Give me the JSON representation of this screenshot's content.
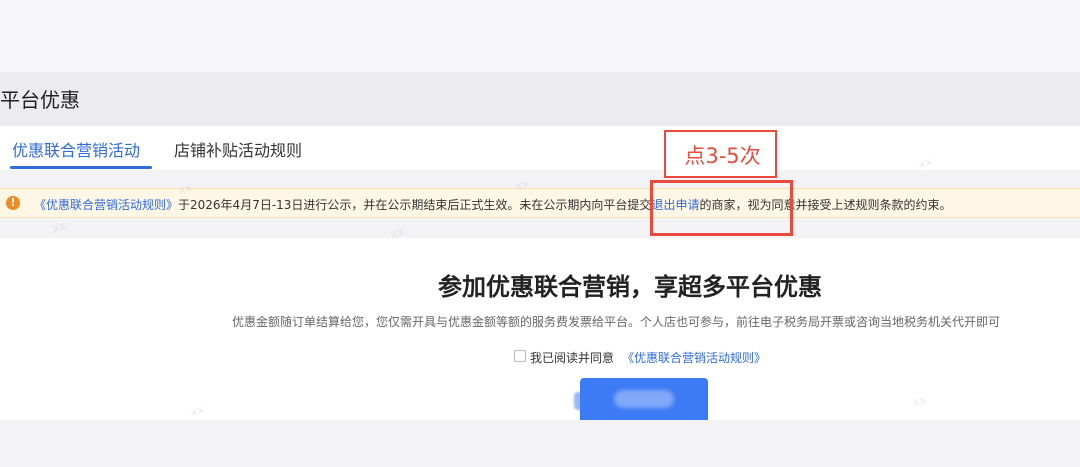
{
  "page": {
    "title": "平台优惠"
  },
  "tabs": [
    {
      "label": "优惠联合营销活动",
      "active": true
    },
    {
      "label": "店铺补贴活动规则",
      "active": false
    }
  ],
  "notice": {
    "icon": "warning-circle-icon",
    "icon_glyph": "!",
    "rules_link": "《优惠联合营销活动规则》",
    "text_before": "于2026年4月7日-13日进行公示，并在公示期结束后正式生效。未在公示期内向平台提交",
    "exit_link": "退出申请",
    "text_after": "的商家，视为同意并接受上述规则条款的约束。"
  },
  "annotation": {
    "label": "点3-5次",
    "color": "#e84b3c"
  },
  "main": {
    "title": "参加优惠联合营销，享超多平台优惠",
    "description": "优惠金额随订单结算给您，您仅需开具与优惠金额等额的服务费发票给平台。个人店也可参与，前往电子税务局开票或咨询当地税务机关代开即可",
    "agree_text": "我已阅读并同意",
    "agree_link": "《优惠联合营销活动规则》",
    "button_label": ""
  },
  "colors": {
    "accent": "#2f6bdc",
    "warning": "#f08a24",
    "notice_bg": "#fff7e6",
    "button": "#3d7af5"
  }
}
